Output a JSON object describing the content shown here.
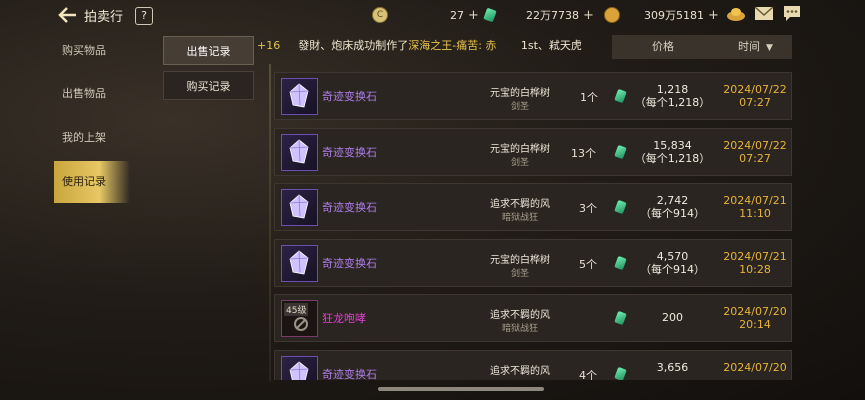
{
  "header": {
    "title": "拍卖行",
    "help": "?"
  },
  "currencies": [
    {
      "icon": "c-coin-icon",
      "value": "27"
    },
    {
      "icon": "green-gem-icon",
      "value": "22万7738"
    },
    {
      "icon": "gold-coin-icon",
      "value": "309万5181"
    }
  ],
  "sidebar": {
    "items": [
      {
        "label": "购买物品"
      },
      {
        "label": "出售物品"
      },
      {
        "label": "我的上架"
      },
      {
        "label": "使用记录",
        "active": true
      }
    ]
  },
  "tabs": [
    {
      "label": "出售记录",
      "active": true
    },
    {
      "label": "购买记录"
    }
  ],
  "ticker": {
    "prefix": "+16",
    "text": "發財、炮床成功制作了",
    "highlight": "深海之王-痛苦: 赤",
    "suffix": "1st、弒天虎"
  },
  "columns": {
    "price": "价格",
    "time": "时间"
  },
  "rows": [
    {
      "name": "奇迹变换石",
      "seller": "元宝的白桦树",
      "class": "剑圣",
      "qty": "1个",
      "total": "1,218",
      "unit": "（每个1,218）",
      "date": "2024/07/22",
      "time": "07:27"
    },
    {
      "name": "奇迹变换石",
      "seller": "元宝的白桦树",
      "class": "剑圣",
      "qty": "13个",
      "total": "15,834",
      "unit": "（每个1,218）",
      "date": "2024/07/22",
      "time": "07:27"
    },
    {
      "name": "奇迹变换石",
      "seller": "追求不羁的风",
      "class": "暗狱战狂",
      "qty": "3个",
      "total": "2,742",
      "unit": "（每个914）",
      "date": "2024/07/21",
      "time": "11:10"
    },
    {
      "name": "奇迹变换石",
      "seller": "元宝的白桦树",
      "class": "剑圣",
      "qty": "5个",
      "total": "4,570",
      "unit": "（每个914）",
      "date": "2024/07/21",
      "time": "10:28"
    },
    {
      "name": "狂龙咆哮",
      "level": "45级",
      "seller": "追求不羁的风",
      "class": "暗狱战狂",
      "qty": "",
      "total": "200",
      "unit": "",
      "date": "2024/07/20",
      "time": "20:14"
    },
    {
      "name": "奇迹变换石",
      "seller": "追求不羁的风",
      "class": "",
      "qty": "4个",
      "total": "3,656",
      "unit": "",
      "date": "2024/07/20",
      "time": ""
    }
  ]
}
